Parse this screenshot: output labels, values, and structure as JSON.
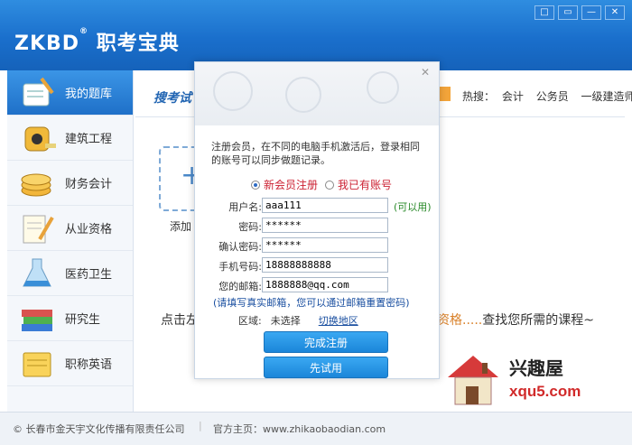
{
  "app": {
    "logo": "ZKBD",
    "logo_mark": "®",
    "title": "职考宝典"
  },
  "window_buttons": [
    "□",
    "▭",
    "—",
    "✕"
  ],
  "sidebar": {
    "items": [
      {
        "label": "我的题库",
        "icon": "notebook-pencil-icon",
        "active": true
      },
      {
        "label": "建筑工程",
        "icon": "tape-measure-icon"
      },
      {
        "label": "财务会计",
        "icon": "coins-icon"
      },
      {
        "label": "从业资格",
        "icon": "certificate-pen-icon"
      },
      {
        "label": "医药卫生",
        "icon": "flask-icon"
      },
      {
        "label": "研究生",
        "icon": "books-icon"
      },
      {
        "label": "职称英语",
        "icon": "notepad-icon"
      }
    ]
  },
  "main": {
    "search_title": "搜考试",
    "hot_label": "热搜：",
    "hot_links": [
      "会计",
      "公务员",
      "一级建造师"
    ],
    "add_label": "添加",
    "tip_prefix": "点击左",
    "tip_highlight": "资格.....",
    "tip_suffix": "查找您所需的课程~"
  },
  "status": {
    "copyright": "© 长春市金天宇文化传播有限责任公司",
    "home": "官方主页：www.zhikaobaodian.com"
  },
  "dialog": {
    "close": "✕",
    "description": "注册会员，在不同的电脑手机激活后，登录相同的账号可以同步做题记录。",
    "radio_new": "新会员注册",
    "radio_existing": "我已有账号",
    "fields": {
      "username": {
        "label": "用户名:",
        "value": "aaa111",
        "hint": "(可以用)"
      },
      "password": {
        "label": "密码:",
        "value": "******"
      },
      "confirm": {
        "label": "确认密码:",
        "value": "******"
      },
      "phone": {
        "label": "手机号码:",
        "value": "18888888888"
      },
      "email": {
        "label": "您的邮箱:",
        "value": "1888888@qq.com"
      }
    },
    "mail_note": "(请填写真实邮箱，您可以通过邮箱重置密码)",
    "region_label": "区域:",
    "region_value": "未选择",
    "region_switch": "切换地区",
    "submit": "完成注册",
    "trial": "先试用"
  },
  "watermark": {
    "cn": "兴趣屋",
    "url": "xqu5.com"
  }
}
